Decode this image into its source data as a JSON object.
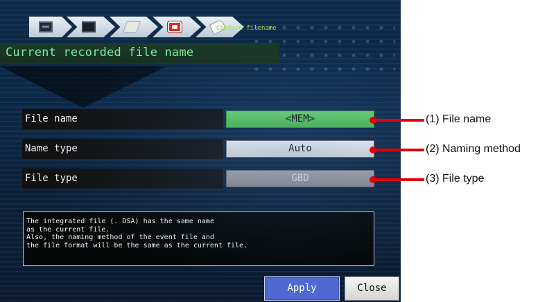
{
  "header": {
    "step_caption": "Capture filename",
    "steps": [
      {
        "icon": "monitor-icon"
      },
      {
        "icon": "screen-icon"
      },
      {
        "icon": "scan-icon"
      },
      {
        "icon": "record-icon"
      },
      {
        "icon": "tag-icon"
      }
    ]
  },
  "page_title": "Current recorded file name",
  "settings": [
    {
      "label": "File name",
      "value": "<MEM>"
    },
    {
      "label": "Name type",
      "value": "Auto"
    },
    {
      "label": "File type",
      "value": "GBD"
    }
  ],
  "note": {
    "lines": [
      "The integrated file (. DSA) has the same name",
      "as the current file.",
      "Also, the naming method of the event file and",
      "the file format will be the same as the current file."
    ]
  },
  "buttons": {
    "apply": "Apply",
    "close": "Close"
  },
  "callouts": [
    "(1) File name",
    "(2) Naming method",
    "(3) File type"
  ],
  "colors": {
    "callout_line": "#e3000e",
    "title_text": "#7ef09a",
    "file_name_value_bg": "#5cc55c",
    "apply_button_bg": "#4e6ad2"
  }
}
